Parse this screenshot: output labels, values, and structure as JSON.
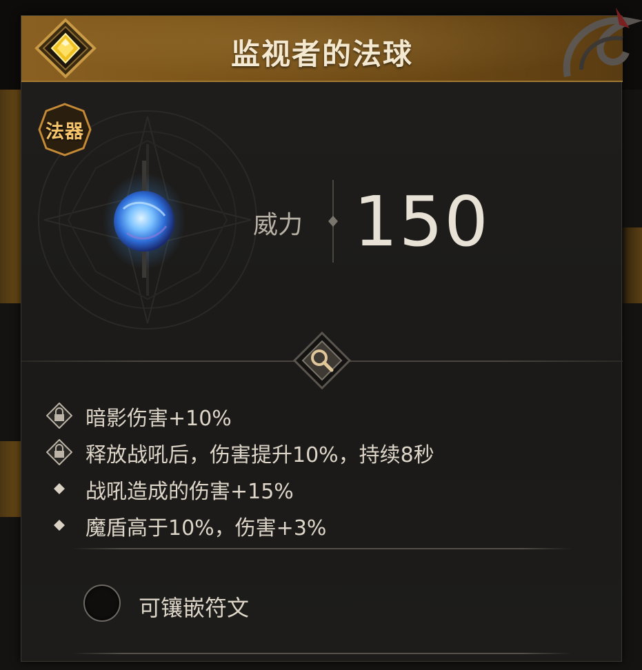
{
  "item": {
    "name": "监视者的法球",
    "type_badge": "法器"
  },
  "stat": {
    "label": "威力",
    "value": "150"
  },
  "affixes": [
    {
      "icon": "lock-diamond-icon",
      "text": "暗影伤害+10%"
    },
    {
      "icon": "lock-diamond-icon",
      "text": "释放战吼后，伤害提升10%，持续8秒"
    },
    {
      "icon": "diamond-bullet-icon",
      "text": "战吼造成的伤害+15%"
    },
    {
      "icon": "diamond-bullet-icon",
      "text": "魔盾高于10%，伤害+3%"
    }
  ],
  "socket": {
    "label": "可镶嵌符文"
  },
  "colors": {
    "title_bar": "#7b5419",
    "badge_text": "#f6c46a",
    "orb_glow": "#5aa8ff",
    "body_text": "#ddd6c9"
  }
}
